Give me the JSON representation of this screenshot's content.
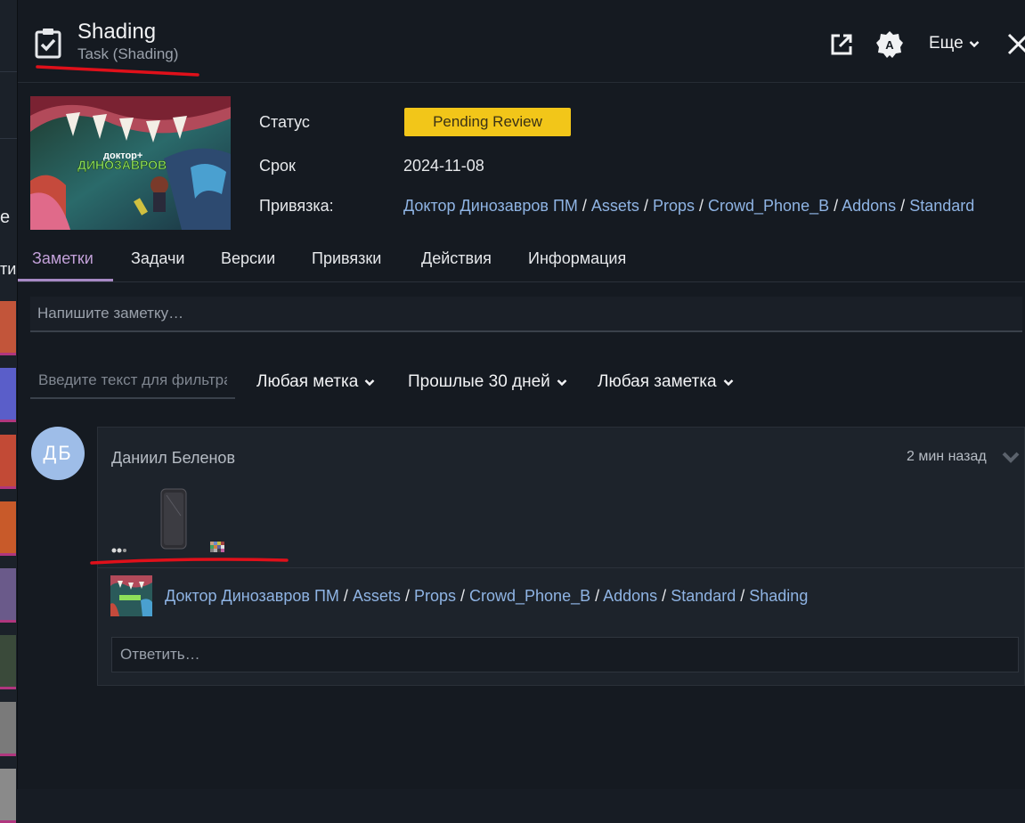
{
  "background": {
    "fragments": [
      "е",
      "тир"
    ]
  },
  "header": {
    "title": "Shading",
    "subtitle": "Task (Shading)",
    "more_label": "Еще",
    "avatar_letter": "A"
  },
  "info": {
    "poster_logo_top": "доктор+",
    "poster_logo_bottom": "ДИНОЗАВРОВ",
    "status_label": "Статус",
    "status_value": "Pending Review",
    "due_label": "Срок",
    "due_value": "2024-11-08",
    "link_label": "Привязка:",
    "link_path": [
      "Доктор Динозавров ПМ",
      "Assets",
      "Props",
      "Crowd_Phone_B",
      "Addons",
      "Standard"
    ]
  },
  "tabs": [
    {
      "label": "Заметки",
      "active": true
    },
    {
      "label": "Задачи",
      "active": false
    },
    {
      "label": "Версии",
      "active": false
    },
    {
      "label": "Привязки",
      "active": false
    },
    {
      "label": "Действия",
      "active": false
    },
    {
      "label": "Информация",
      "active": false
    }
  ],
  "note_input": {
    "placeholder": "Напишите заметку…"
  },
  "filters": {
    "text_placeholder": "Введите текст для фильтрации",
    "tag_label": "Любая метка",
    "period_label": "Прошлые 30 дней",
    "note_type_label": "Любая заметка"
  },
  "note": {
    "avatar_initials": "ДБ",
    "author": "Даниил Беленов",
    "time": "2 мин назад",
    "context_path": [
      "Доктор Динозавров ПМ",
      "Assets",
      "Props",
      "Crowd_Phone_B",
      "Addons",
      "Standard",
      "Shading"
    ],
    "reply_placeholder": "Ответить…"
  },
  "colors": {
    "status_badge": "#f2c619",
    "active_tab": "#c2a0d8",
    "link": "#8fb4e4",
    "annotation_red": "#e0101a",
    "avatar": "#9ebde8"
  }
}
